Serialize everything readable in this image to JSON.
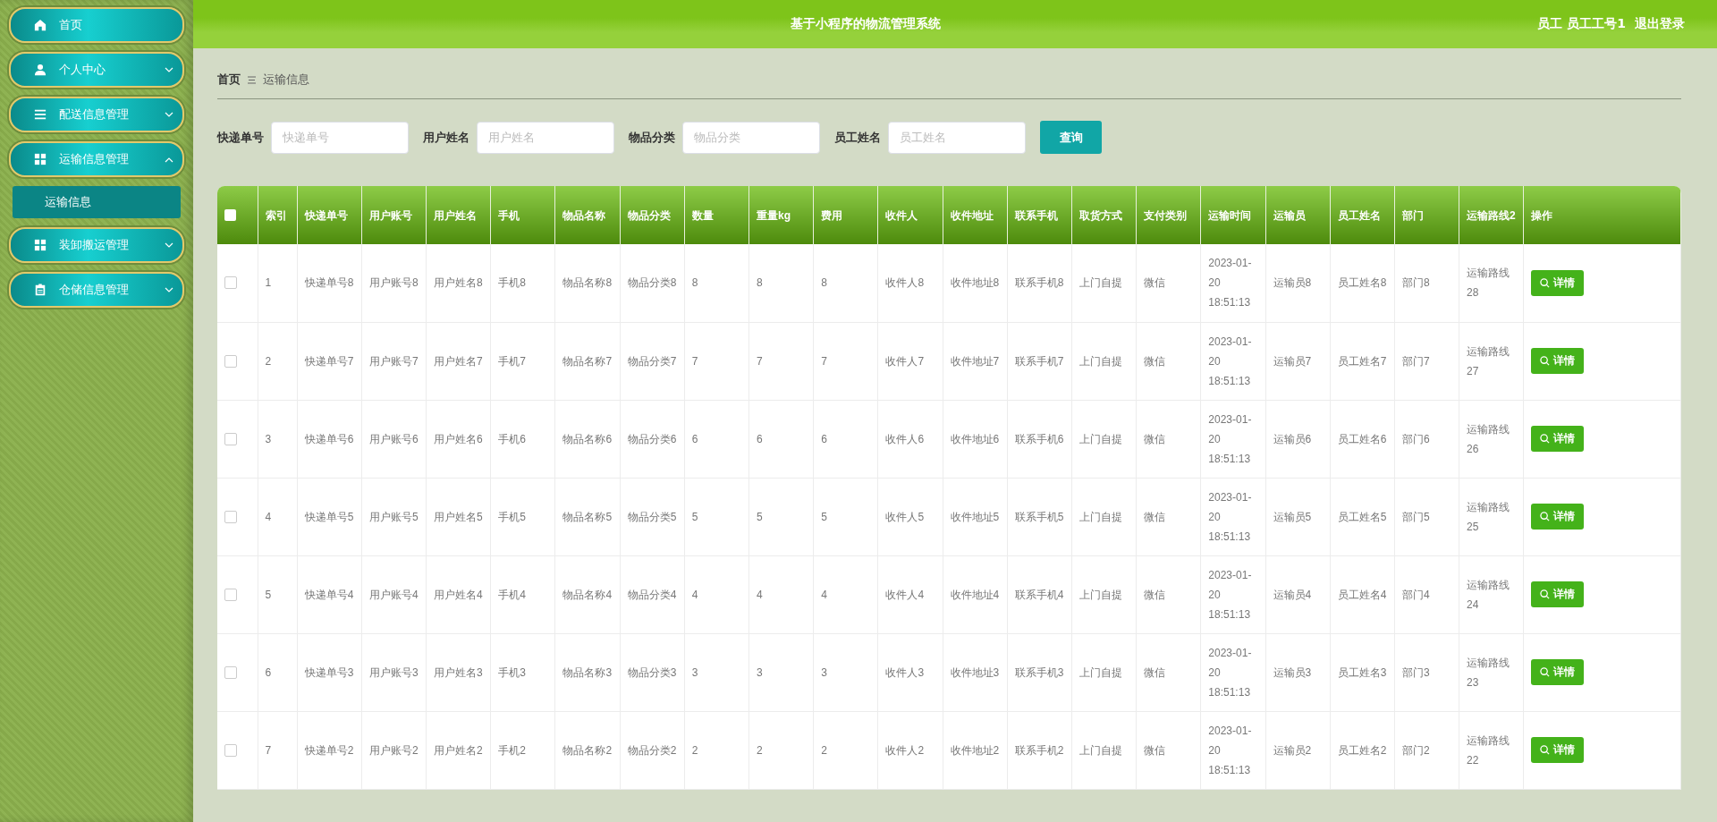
{
  "sidebar": {
    "items": [
      {
        "label": "首页",
        "kind": "link"
      },
      {
        "label": "个人中心",
        "kind": "menu",
        "expanded": false
      },
      {
        "label": "配送信息管理",
        "kind": "menu",
        "expanded": false
      },
      {
        "label": "运输信息管理",
        "kind": "menu",
        "expanded": true,
        "children": [
          {
            "label": "运输信息",
            "selected": true
          }
        ]
      },
      {
        "label": "装卸搬运管理",
        "kind": "menu",
        "expanded": false
      },
      {
        "label": "仓储信息管理",
        "kind": "menu",
        "expanded": false
      }
    ]
  },
  "header": {
    "title": "基于小程序的物流管理系统",
    "user": "员工 员工工号1",
    "logout": "退出登录"
  },
  "breadcrumb": [
    "首页",
    "运输信息"
  ],
  "search": {
    "fields": [
      {
        "label": "快递单号",
        "placeholder": "快递单号"
      },
      {
        "label": "用户姓名",
        "placeholder": "用户姓名"
      },
      {
        "label": "物品分类",
        "placeholder": "物品分类"
      },
      {
        "label": "员工姓名",
        "placeholder": "员工姓名"
      }
    ],
    "button": "查询"
  },
  "table": {
    "select_all_checked": false,
    "columns": [
      "索引",
      "快递单号",
      "用户账号",
      "用户姓名",
      "手机",
      "物品名称",
      "物品分类",
      "数量",
      "重量kg",
      "费用",
      "收件人",
      "收件地址",
      "联系手机",
      "取货方式",
      "支付类别",
      "运输时间",
      "运输员",
      "员工姓名",
      "部门",
      "运输路线2",
      "操作"
    ],
    "rows": [
      {
        "checked": false,
        "cells": [
          "1",
          "快递单号8",
          "用户账号8",
          "用户姓名8",
          "手机8",
          "物品名称8",
          "物品分类8",
          "8",
          "8",
          "8",
          "收件人8",
          "收件地址8",
          "联系手机8",
          "上门自提",
          "微信",
          "2023-01-20 18:51:13",
          "运输员8",
          "员工姓名8",
          "部门8",
          "运输路线28"
        ],
        "action": "详情"
      },
      {
        "checked": false,
        "cells": [
          "2",
          "快递单号7",
          "用户账号7",
          "用户姓名7",
          "手机7",
          "物品名称7",
          "物品分类7",
          "7",
          "7",
          "7",
          "收件人7",
          "收件地址7",
          "联系手机7",
          "上门自提",
          "微信",
          "2023-01-20 18:51:13",
          "运输员7",
          "员工姓名7",
          "部门7",
          "运输路线27"
        ],
        "action": "详情"
      },
      {
        "checked": false,
        "cells": [
          "3",
          "快递单号6",
          "用户账号6",
          "用户姓名6",
          "手机6",
          "物品名称6",
          "物品分类6",
          "6",
          "6",
          "6",
          "收件人6",
          "收件地址6",
          "联系手机6",
          "上门自提",
          "微信",
          "2023-01-20 18:51:13",
          "运输员6",
          "员工姓名6",
          "部门6",
          "运输路线26"
        ],
        "action": "详情"
      },
      {
        "checked": false,
        "cells": [
          "4",
          "快递单号5",
          "用户账号5",
          "用户姓名5",
          "手机5",
          "物品名称5",
          "物品分类5",
          "5",
          "5",
          "5",
          "收件人5",
          "收件地址5",
          "联系手机5",
          "上门自提",
          "微信",
          "2023-01-20 18:51:13",
          "运输员5",
          "员工姓名5",
          "部门5",
          "运输路线25"
        ],
        "action": "详情"
      },
      {
        "checked": false,
        "cells": [
          "5",
          "快递单号4",
          "用户账号4",
          "用户姓名4",
          "手机4",
          "物品名称4",
          "物品分类4",
          "4",
          "4",
          "4",
          "收件人4",
          "收件地址4",
          "联系手机4",
          "上门自提",
          "微信",
          "2023-01-20 18:51:13",
          "运输员4",
          "员工姓名4",
          "部门4",
          "运输路线24"
        ],
        "action": "详情"
      },
      {
        "checked": false,
        "cells": [
          "6",
          "快递单号3",
          "用户账号3",
          "用户姓名3",
          "手机3",
          "物品名称3",
          "物品分类3",
          "3",
          "3",
          "3",
          "收件人3",
          "收件地址3",
          "联系手机3",
          "上门自提",
          "微信",
          "2023-01-20 18:51:13",
          "运输员3",
          "员工姓名3",
          "部门3",
          "运输路线23"
        ],
        "action": "详情"
      },
      {
        "checked": false,
        "cells": [
          "7",
          "快递单号2",
          "用户账号2",
          "用户姓名2",
          "手机2",
          "物品名称2",
          "物品分类2",
          "2",
          "2",
          "2",
          "收件人2",
          "收件地址2",
          "联系手机2",
          "上门自提",
          "微信",
          "2023-01-20 18:51:13",
          "运输员2",
          "员工姓名2",
          "部门2",
          "运输路线22"
        ],
        "action": "详情"
      }
    ]
  }
}
